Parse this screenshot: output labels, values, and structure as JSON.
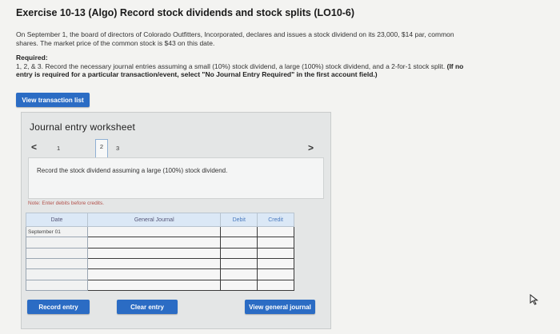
{
  "header": {
    "title": "Exercise 10-13 (Algo) Record stock dividends and stock splits (LO10-6)"
  },
  "problem": {
    "paragraph": "On September 1, the board of directors of Colorado Outfitters, Incorporated, declares and issues a stock dividend on its 23,000, $14 par, common shares. The market price of the common stock is $43 on this date.",
    "required_heading": "Required:",
    "required_text": "1, 2, & 3. Record the necessary journal entries assuming a small (10%) stock dividend, a large (100%) stock dividend, and a 2-for-1 stock split.",
    "required_bold": "(If no entry is required for a particular transaction/event, select \"No Journal Entry Required\" in the first account field.)"
  },
  "buttons": {
    "view_transaction_list": "View transaction list",
    "record_entry": "Record entry",
    "clear_entry": "Clear entry",
    "view_general_journal": "View general journal"
  },
  "worksheet": {
    "title": "Journal entry worksheet",
    "prev_arrow": "<",
    "next_arrow": ">",
    "pages": [
      "1",
      "2",
      "3"
    ],
    "active_page": "2",
    "instruction": "Record the stock dividend assuming a large (100%) stock dividend.",
    "note": "Note: Enter debits before credits."
  },
  "journal": {
    "columns": [
      "Date",
      "General Journal",
      "Debit",
      "Credit"
    ],
    "rows": [
      {
        "date": "September 01",
        "account": "",
        "debit": "",
        "credit": ""
      },
      {
        "date": "",
        "account": "",
        "debit": "",
        "credit": ""
      },
      {
        "date": "",
        "account": "",
        "debit": "",
        "credit": ""
      },
      {
        "date": "",
        "account": "",
        "debit": "",
        "credit": ""
      },
      {
        "date": "",
        "account": "",
        "debit": "",
        "credit": ""
      },
      {
        "date": "",
        "account": "",
        "debit": "",
        "credit": ""
      }
    ]
  },
  "colors": {
    "button_blue": "#2b6cc4",
    "header_blue": "#dbe8f6",
    "note_red": "#b3514b"
  }
}
